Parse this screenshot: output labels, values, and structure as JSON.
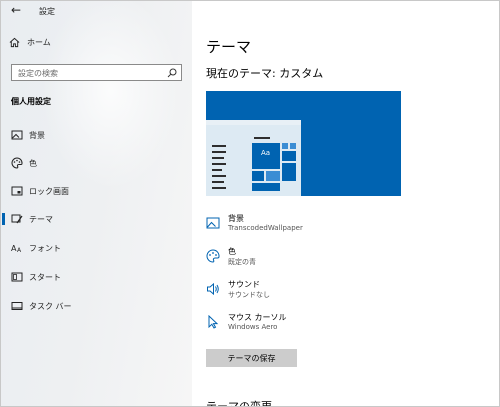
{
  "window": {
    "title": "設定"
  },
  "sidebar": {
    "home_label": "ホーム",
    "search_placeholder": "設定の検索",
    "section_title": "個人用設定",
    "items": [
      {
        "label": "背景",
        "icon": "image-icon"
      },
      {
        "label": "色",
        "icon": "palette-icon"
      },
      {
        "label": "ロック画面",
        "icon": "lock-screen-icon"
      },
      {
        "label": "テーマ",
        "icon": "theme-brush-icon",
        "active": true
      },
      {
        "label": "フォント",
        "icon": "font-icon"
      },
      {
        "label": "スタート",
        "icon": "start-icon"
      },
      {
        "label": "タスク バー",
        "icon": "taskbar-icon"
      }
    ]
  },
  "main": {
    "title": "テーマ",
    "current_theme": "現在のテーマ: カスタム",
    "preview_text": "Aa",
    "options": [
      {
        "label": "背景",
        "value": "TranscodedWallpaper",
        "icon": "image-icon"
      },
      {
        "label": "色",
        "value": "既定の青",
        "icon": "palette-icon"
      },
      {
        "label": "サウンド",
        "value": "サウンドなし",
        "icon": "speaker-icon"
      },
      {
        "label": "マウス カーソル",
        "value": "Windows Aero",
        "icon": "cursor-icon"
      }
    ],
    "save_button": "テーマの保存",
    "change_title": "テーマの変更"
  },
  "colors": {
    "accent": "#0063b1",
    "button": "#cccccc"
  }
}
